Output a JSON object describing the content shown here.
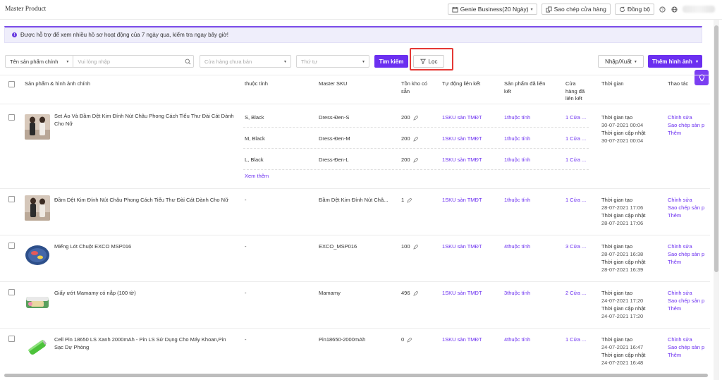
{
  "app": {
    "title": "Master Product"
  },
  "topbar": {
    "store_selector": "Genie Business(20 Ngày)",
    "copy_store_label": "Sao chép cửa hàng",
    "sync_label": "Đồng bộ",
    "icons": [
      "calendar-icon",
      "copy-icon",
      "sync-icon",
      "help-icon",
      "globe-icon"
    ]
  },
  "notice": {
    "text": "Được hỗ trợ để xem nhiều hồ sơ hoạt động của 7 ngày qua, kiểm tra ngay bây giờ!"
  },
  "filters": {
    "search_field_select": "Tên sản phẩm chính",
    "search_placeholder": "Vui lòng nhập",
    "store_placeholder": "Cửa hàng chưa bán",
    "order_placeholder": "Thứ tự",
    "search_button": "Tìm kiếm",
    "filter_button": "Lọc",
    "import_export": "Nhập/Xuất",
    "add_image": "Thêm hình ảnh"
  },
  "table": {
    "headers": {
      "product": "Sản phẩm & hình ảnh chính",
      "attribute": "thuộc tính",
      "sku": "Master SKU",
      "stock_1": "Tồn kho có",
      "stock_2": "sẵn",
      "autolink": "Tự động liên kết",
      "linked_1": "Sản phẩm đã liên",
      "linked_2": "kết",
      "stores_1": "Cửa",
      "stores_2": "hàng đã",
      "stores_3": "liên kết",
      "time": "Thời gian",
      "actions": "Thao tác"
    },
    "labels": {
      "created": "Thời gian tạo",
      "updated": "Thời gian cập nhật",
      "edit": "Chỉnh sửa",
      "copy_product": "Sao chép sản p",
      "add": "Thêm",
      "see_more": "Xem thêm"
    },
    "rows": [
      {
        "name_1": "Set Áo Và Đầm Dệt Kim Đính Nút Châu Phong Cách Tiểu Thư Đài Cát Dành",
        "name_2": "Cho Nữ",
        "variants": [
          {
            "attr": "S, Black",
            "sku": "Dress-Đen-S",
            "stock": "200",
            "autolink": "1SKU sàn TMĐT",
            "linked": "1thuộc tính",
            "stores": "1 Cửa ..."
          },
          {
            "attr": "M, Black",
            "sku": "Dress-Đen-M",
            "stock": "200",
            "autolink": "1SKU sàn TMĐT",
            "linked": "1thuộc tính",
            "stores": "1 Cửa ..."
          },
          {
            "attr": "L, Black",
            "sku": "Dress-Đen-L",
            "stock": "200",
            "autolink": "1SKU sàn TMĐT",
            "linked": "1thuộc tính",
            "stores": "1 Cửa ..."
          }
        ],
        "created": "30-07-2021 00:04",
        "updated": "30-07-2021 00:04"
      },
      {
        "name_1": "Đầm Dệt Kim Đính Nút Châu Phong Cách Tiểu Thư Đài Cát Dành Cho Nữ",
        "attr": "-",
        "sku": "Đầm Dệt Kim Đính Nút Châ...",
        "stock": "1",
        "autolink": "1SKU sàn TMĐT",
        "linked": "1thuộc tính",
        "stores": "1 Cửa ...",
        "created": "28-07-2021 17:06",
        "updated": "28-07-2021 17:06"
      },
      {
        "name_1": "Miếng Lót Chuột EXCO MSP016",
        "attr": "-",
        "sku": "EXCO_MSP016",
        "stock": "100",
        "autolink": "1SKU sàn TMĐT",
        "linked": "4thuộc tính",
        "stores": "3 Cửa ...",
        "created": "28-07-2021 16:38",
        "updated": "28-07-2021 16:39"
      },
      {
        "name_1": "Giấy ướt Mamamy có nắp (100 tờ)",
        "attr": "-",
        "sku": "Mamamy",
        "stock": "496",
        "autolink": "1SKU sàn TMĐT",
        "linked": "3thuộc tính",
        "stores": "2 Cửa ...",
        "created": "24-07-2021 17:20",
        "updated": "24-07-2021 17:20"
      },
      {
        "name_1": "Cell Pin 18650 LS Xanh 2000mAh - Pin LS Sử Dụng Cho Máy Khoan,Pin",
        "name_2": "Sạc Dự Phòng",
        "attr": "-",
        "sku": "Pin18650-2000mAh",
        "stock": "0",
        "autolink": "1SKU sàn TMĐT",
        "linked": "4thuộc tính",
        "stores": "1 Cửa ...",
        "created": "24-07-2021 16:47",
        "updated": "24-07-2021 16:48"
      }
    ]
  },
  "colors": {
    "accent": "#6b2ff0",
    "highlight": "#e53935",
    "notice_bg": "#efeefb"
  }
}
